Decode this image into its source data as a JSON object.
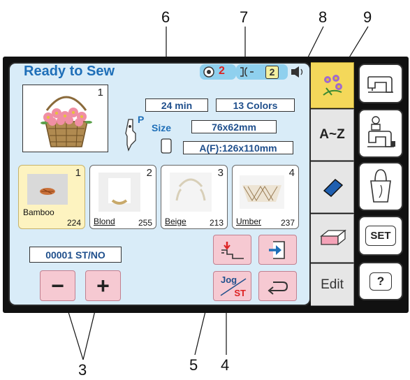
{
  "callouts": {
    "c6": "6",
    "c7": "7",
    "c8": "8",
    "c9": "9",
    "c3": "3",
    "c5": "5",
    "c4": "4"
  },
  "screen": {
    "title": "Ready to Sew",
    "indicator_count_a": "2",
    "indicator_count_b": "2",
    "preview_number": "1",
    "time": "24 min",
    "colors": "13 Colors",
    "presser_foot_label": "P",
    "size_label": "Size",
    "size_value": "76x62mm",
    "hoop_value": "A(F):126x110mm",
    "stitch_counter": "00001 ST/NO",
    "minus_label": "−",
    "plus_label": "+",
    "jog_label": "Jog",
    "st_label": "ST",
    "thread_colors": [
      {
        "num": "1",
        "name": "Bamboo",
        "code": "224"
      },
      {
        "num": "2",
        "name": "Blond",
        "code": "255"
      },
      {
        "num": "3",
        "name": "Beige",
        "code": "213"
      },
      {
        "num": "4",
        "name": "Umber",
        "code": "237"
      }
    ]
  },
  "tabs": {
    "az_label": "A~Z",
    "edit_label": "Edit"
  },
  "side_buttons": {
    "set_label": "SET",
    "help_label": "?"
  },
  "colors": {
    "accent": "#1f6fb8",
    "pink": "#f6c9d2",
    "screen": "#d9ecf8",
    "selected": "#fdf3c0"
  }
}
